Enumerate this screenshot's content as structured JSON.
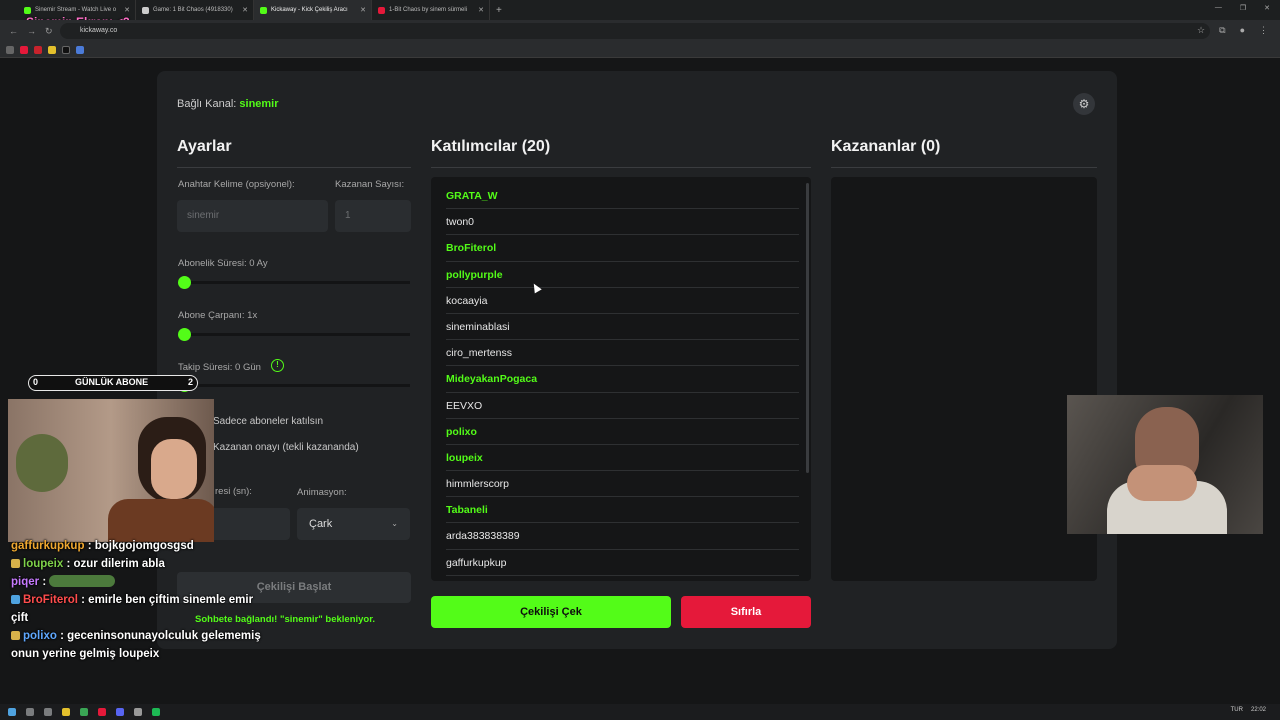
{
  "browser": {
    "tabs": [
      {
        "label": "Sinemir Stream - Watch Live o",
        "color": "#53fc18"
      },
      {
        "label": "Game: 1 Bit Chaos (4918330)",
        "color": "#cccccc"
      },
      {
        "label": "Kickaway - Kick Çekiliş Aracı",
        "color": "#53fc18"
      },
      {
        "label": "1-Bit Chaos by sinem sürmeli",
        "color": "#e5193a"
      }
    ],
    "url": "kickaway.co",
    "overlay_title": "Sinemin Ekranı <3"
  },
  "app": {
    "channel_label": "Bağlı Kanal:",
    "channel_name": "sinemir",
    "settings": {
      "title": "Ayarlar",
      "keyword_label": "Anahtar Kelime (opsiyonel):",
      "keyword_placeholder": "sinemir",
      "winner_count_label": "Kazanan Sayısı:",
      "winner_count_value": "1",
      "sub_duration_label": "Abonelik Süresi: 0 Ay",
      "sub_multiplier_label": "Abone Çarpanı: 1x",
      "follow_duration_label": "Takip Süresi: 0 Gün",
      "info_icon": "!",
      "subs_only_label": "Sadece aboneler katılsın",
      "winner_approval_label": "Kazanan onayı (tekli kazananda)",
      "duration_label": "resi (sn):",
      "animation_label": "Animasyon:",
      "animation_value": "Çark",
      "start_button": "Çekilişi Başlat",
      "status": "Sohbete bağlandı! \"sinemir\" bekleniyor."
    },
    "participants": {
      "title": "Katılımcılar (20)",
      "items": [
        {
          "name": "GRATA_W",
          "sub": true
        },
        {
          "name": "twon0",
          "sub": false
        },
        {
          "name": "BroFiterol",
          "sub": true
        },
        {
          "name": "pollypurple",
          "sub": true
        },
        {
          "name": "kocaayia",
          "sub": false
        },
        {
          "name": "sineminablasi",
          "sub": false
        },
        {
          "name": "ciro_mertenss",
          "sub": false
        },
        {
          "name": "MideyakanPogaca",
          "sub": true
        },
        {
          "name": "EEVXO",
          "sub": false
        },
        {
          "name": "polixo",
          "sub": true
        },
        {
          "name": "loupeix",
          "sub": true
        },
        {
          "name": "himmlerscorp",
          "sub": false
        },
        {
          "name": "Tabaneli",
          "sub": true
        },
        {
          "name": "arda383838389",
          "sub": false
        },
        {
          "name": "gaffurkupkup",
          "sub": false
        }
      ]
    },
    "winners": {
      "title": "Kazananlar (0)"
    },
    "draw_button": "Çekilişi Çek",
    "reset_button": "Sıfırla"
  },
  "stream_overlay": {
    "sub_goal": {
      "current": "0",
      "label": "GÜNLÜK ABONE",
      "target": "2"
    },
    "chat": [
      {
        "user": "gaffurkupkup",
        "message": ": bojkgojomgosgsd",
        "user_class": "u1"
      },
      {
        "user": "loupeix",
        "message": ": ozur dilerim abla",
        "user_class": "u2"
      },
      {
        "user": "piqer",
        "message": ":",
        "user_class": "u3"
      },
      {
        "user": "BroFiterol",
        "message": ": emirle ben çiftim sinemle emir çift",
        "user_class": "u4"
      },
      {
        "user": "polixo",
        "message": ": geceninsonunayolculuk gelememiş onun yerine gelmiş loupeix",
        "user_class": "u5"
      }
    ]
  },
  "taskbar": {
    "lang": "TUR",
    "time": "22:02"
  }
}
